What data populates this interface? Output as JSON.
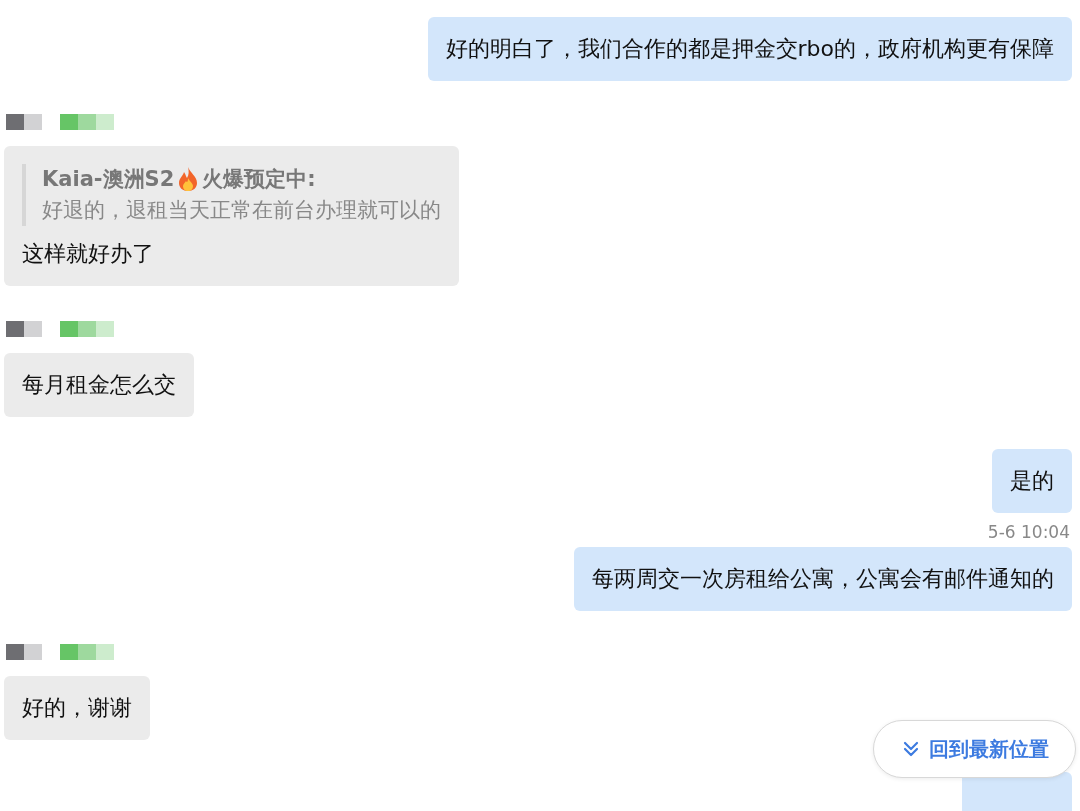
{
  "messages": [
    {
      "kind": "outgoing",
      "text": "好的明白了，我们合作的都是押金交rbo的，政府机构更有保障"
    },
    {
      "kind": "incoming",
      "quote": {
        "author_name": "Kaia-澳洲S2",
        "author_status": "火爆预定中:",
        "text": "好退的，退租当天正常在前台办理就可以的"
      },
      "text": "这样就好办了"
    },
    {
      "kind": "incoming",
      "text": "每月租金怎么交"
    },
    {
      "kind": "outgoing",
      "text": "是的"
    },
    {
      "kind": "timestamp",
      "text": "5-6 10:04"
    },
    {
      "kind": "outgoing",
      "text": "每两周交一次房租给公寓，公寓会有邮件通知的"
    },
    {
      "kind": "incoming",
      "text": "好的，谢谢"
    },
    {
      "kind": "outgoing_cut"
    }
  ],
  "jump_button": {
    "label": "回到最新位置"
  }
}
